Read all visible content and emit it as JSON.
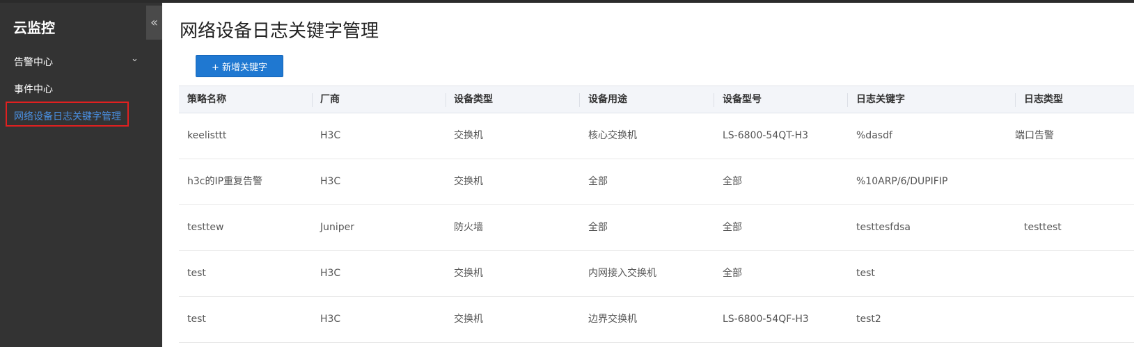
{
  "sidebar": {
    "brand": "云监控",
    "collapse_icon": "«",
    "items": [
      {
        "label": "告警中心",
        "has_chevron": true,
        "chevron": "⌄"
      },
      {
        "label": "事件中心"
      },
      {
        "label": "网络设备日志关键字管理",
        "active": true
      }
    ]
  },
  "main": {
    "title": "网络设备日志关键字管理",
    "add_button": "+ 新增关键字"
  },
  "table": {
    "columns": [
      "策略名称",
      "厂商",
      "设备类型",
      "设备用途",
      "设备型号",
      "日志关键字",
      "日志类型"
    ],
    "rows": [
      [
        "keelisttt",
        "H3C",
        "交换机",
        "核心交换机",
        "LS-6800-54QT-H3",
        "%dasdf",
        "端口告警"
      ],
      [
        "h3c的IP重复告警",
        "H3C",
        "交换机",
        "全部",
        "全部",
        "%10ARP/6/DUPIFIP",
        ""
      ],
      [
        "testtew",
        "Juniper",
        "防火墙",
        "全部",
        "全部",
        "testtesfdsa",
        "testtest"
      ],
      [
        "test",
        "H3C",
        "交换机",
        "内网接入交换机",
        "全部",
        "test",
        ""
      ],
      [
        "test",
        "H3C",
        "交换机",
        "边界交换机",
        "LS-6800-54QF-H3",
        "test2",
        ""
      ]
    ]
  },
  "colors": {
    "sidebar_bg": "#333333",
    "active_text": "#4a90e2",
    "active_outline": "#e02020",
    "primary_button": "#1f78d1"
  }
}
